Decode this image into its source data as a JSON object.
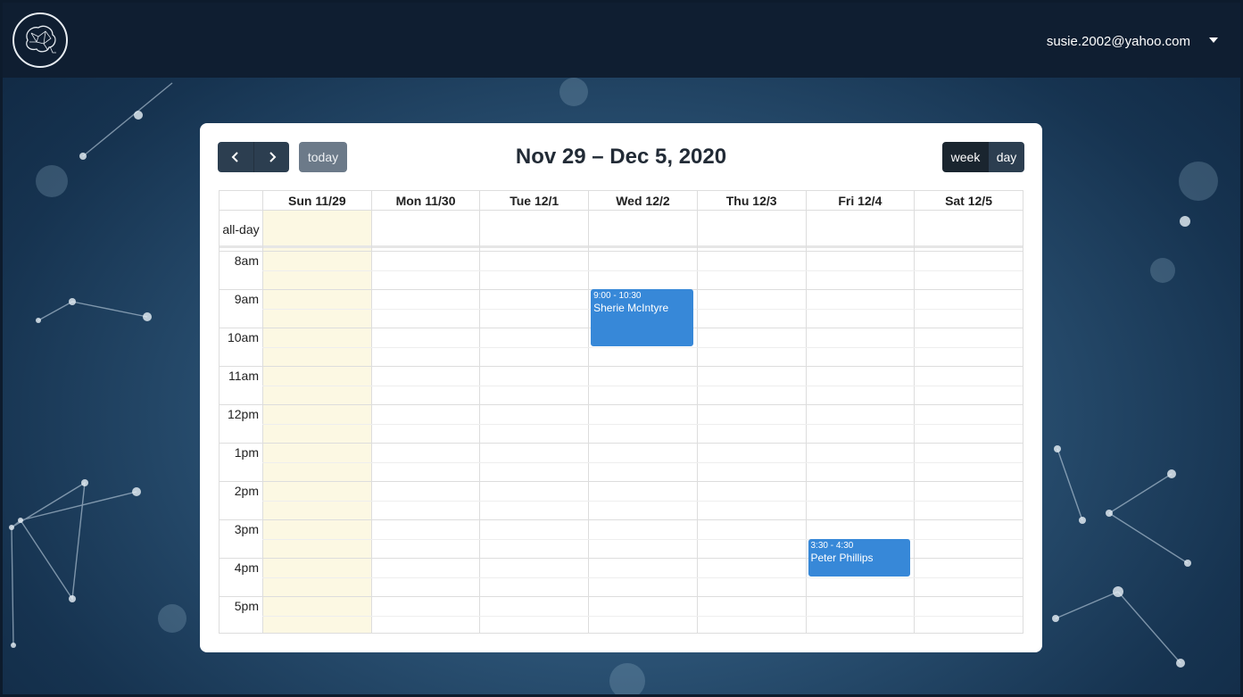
{
  "header": {
    "user_email": "susie.2002@yahoo.com"
  },
  "toolbar": {
    "prev_icon": "chevron-left-icon",
    "next_icon": "chevron-right-icon",
    "today_label": "today",
    "title": "Nov 29 – Dec 5, 2020",
    "week_label": "week",
    "day_label": "day",
    "active_view": "week"
  },
  "calendar": {
    "allday_label": "all-day",
    "days": [
      "Sun 11/29",
      "Mon 11/30",
      "Tue 12/1",
      "Wed 12/2",
      "Thu 12/3",
      "Fri 12/4",
      "Sat 12/5"
    ],
    "today_index": 0,
    "times": [
      "8am",
      "9am",
      "10am",
      "11am",
      "12pm",
      "1pm",
      "2pm",
      "3pm",
      "4pm",
      "5pm"
    ],
    "events": [
      {
        "day": "Wed 12/2",
        "time": "9:00 - 10:30",
        "title": "Sherie McIntyre",
        "color": "#3788d8"
      },
      {
        "day": "Fri 12/4",
        "time": "3:30 - 4:30",
        "title": "Peter Phillips",
        "color": "#3788d8"
      }
    ]
  },
  "colors": {
    "topbar": "#0f1e31",
    "button": "#2c3e50",
    "today_button": "#6c7a89",
    "today_highlight": "#fcf8e3",
    "event": "#3788d8"
  }
}
